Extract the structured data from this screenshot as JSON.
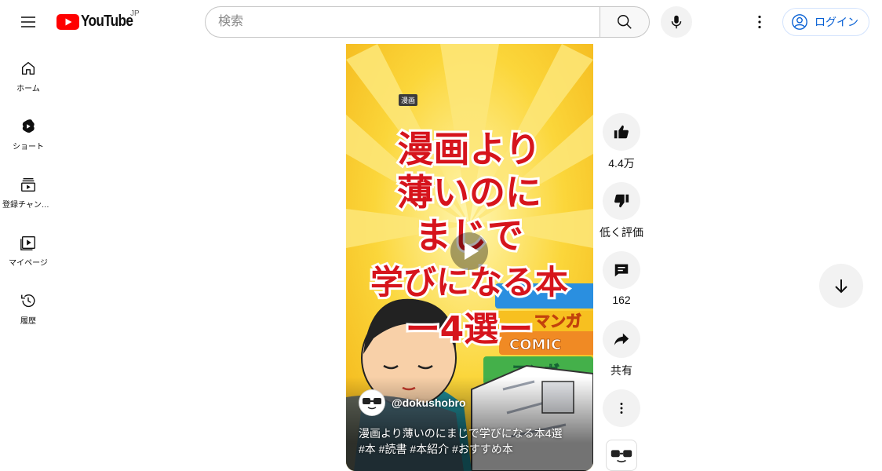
{
  "header": {
    "logo_text": "YouTube",
    "region": "JP",
    "search_placeholder": "検索",
    "signin_label": "ログイン"
  },
  "sidebar": {
    "items": [
      {
        "label": "ホーム",
        "icon": "home-icon"
      },
      {
        "label": "ショート",
        "icon": "shorts-icon"
      },
      {
        "label": "登録チャンネル",
        "icon": "subscriptions-icon"
      },
      {
        "label": "マイページ",
        "icon": "library-icon"
      },
      {
        "label": "履歴",
        "icon": "history-icon"
      }
    ]
  },
  "video": {
    "small_tag": "漫画",
    "thumb_line1": "漫画より",
    "thumb_line2": "薄いのに",
    "thumb_line3": "まじで",
    "thumb_line4": "学びになる本",
    "thumb_line5": "ー4選ー",
    "book_spine1": "マンガ",
    "book_spine2": "COMIC",
    "book_spine3": "マンガ",
    "channel": "@dokushobro",
    "title_line1": "漫画より薄いのにまじで学びになる本4選",
    "title_line2": "#本 #読書 #本紹介 #おすすめ本"
  },
  "actions": {
    "like_count": "4.4万",
    "dislike_label": "低く評価",
    "comment_count": "162",
    "share_label": "共有"
  },
  "colors": {
    "brand_red": "#ff0000",
    "link_blue": "#065fd4",
    "thumb_yellow": "#f9c82a",
    "thumb_text_red": "#d6141c"
  }
}
